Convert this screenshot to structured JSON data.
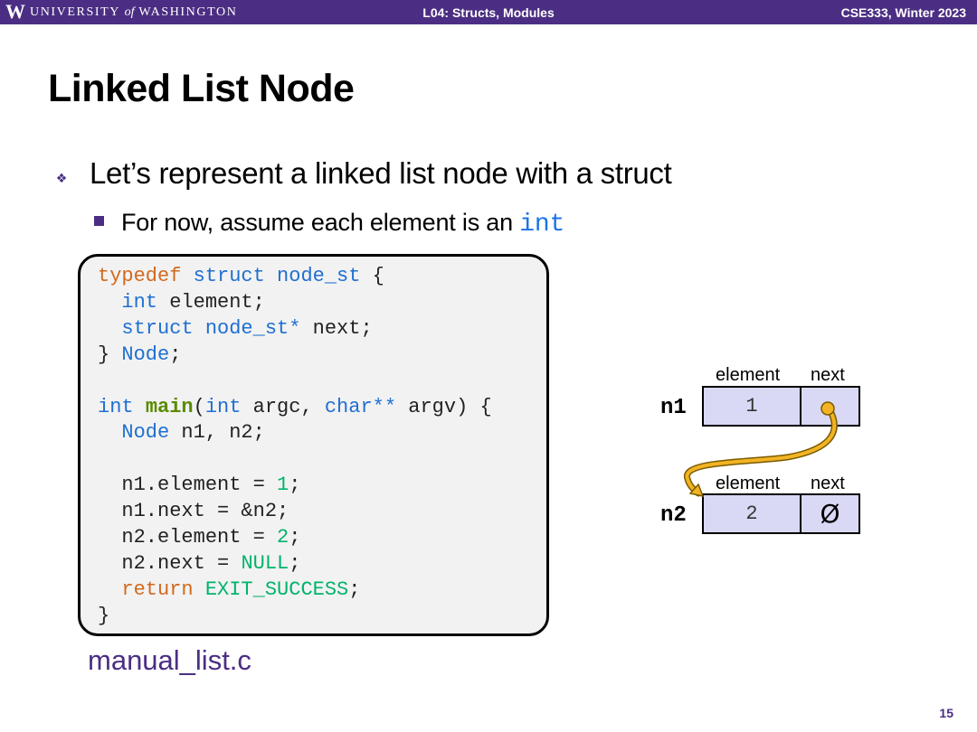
{
  "header": {
    "logo": "W",
    "university_left": "UNIVERSITY",
    "university_of": "of",
    "university_right": "WASHINGTON",
    "lecture": "L04:  Structs, Modules",
    "course": "CSE333, Winter 2023",
    "bar_color": "#4b2e83"
  },
  "slide": {
    "title": "Linked List Node",
    "bullet1_icon": "diamond-bullet-icon",
    "bullet1": "Let’s represent a linked list node with a struct",
    "bullet2_text": "For now, assume each element is an ",
    "bullet2_code": "int",
    "filename": "manual_list.c",
    "page_number": "15"
  },
  "code": {
    "l1_a": "typedef",
    "l1_b": "struct",
    "l1_c": "node_st",
    "l1_d": " {",
    "l2_a": "int",
    "l2_b": " element;",
    "l3_a": "struct",
    "l3_b": "node_st*",
    "l3_c": " next;",
    "l4_a": "} ",
    "l4_b": "Node",
    "l4_c": ";",
    "l6_a": "int",
    "l6_b": "main",
    "l6_c": "(",
    "l6_d": "int",
    "l6_e": " argc, ",
    "l6_f": "char**",
    "l6_g": " argv) {",
    "l7_a": "Node",
    "l7_b": " n1, n2;",
    "l9_a": "n1.element = ",
    "l9_b": "1",
    "l9_c": ";",
    "l10": "n1.next = &n2;",
    "l11_a": "n2.element = ",
    "l11_b": "2",
    "l11_c": ";",
    "l12_a": "n2.next = ",
    "l12_b": "NULL",
    "l12_c": ";",
    "l13_a": "return",
    "l13_b": "EXIT_SUCCESS",
    "l13_c": ";",
    "l14": "}"
  },
  "diagram": {
    "n1": {
      "name": "n1",
      "element_label": "element",
      "next_label": "next",
      "element_value": "1"
    },
    "n2": {
      "name": "n2",
      "element_label": "element",
      "next_label": "next",
      "element_value": "2",
      "next_value": "Ø"
    },
    "cell_color": "#d9d9f5",
    "arrow_color": "#f2b324"
  }
}
